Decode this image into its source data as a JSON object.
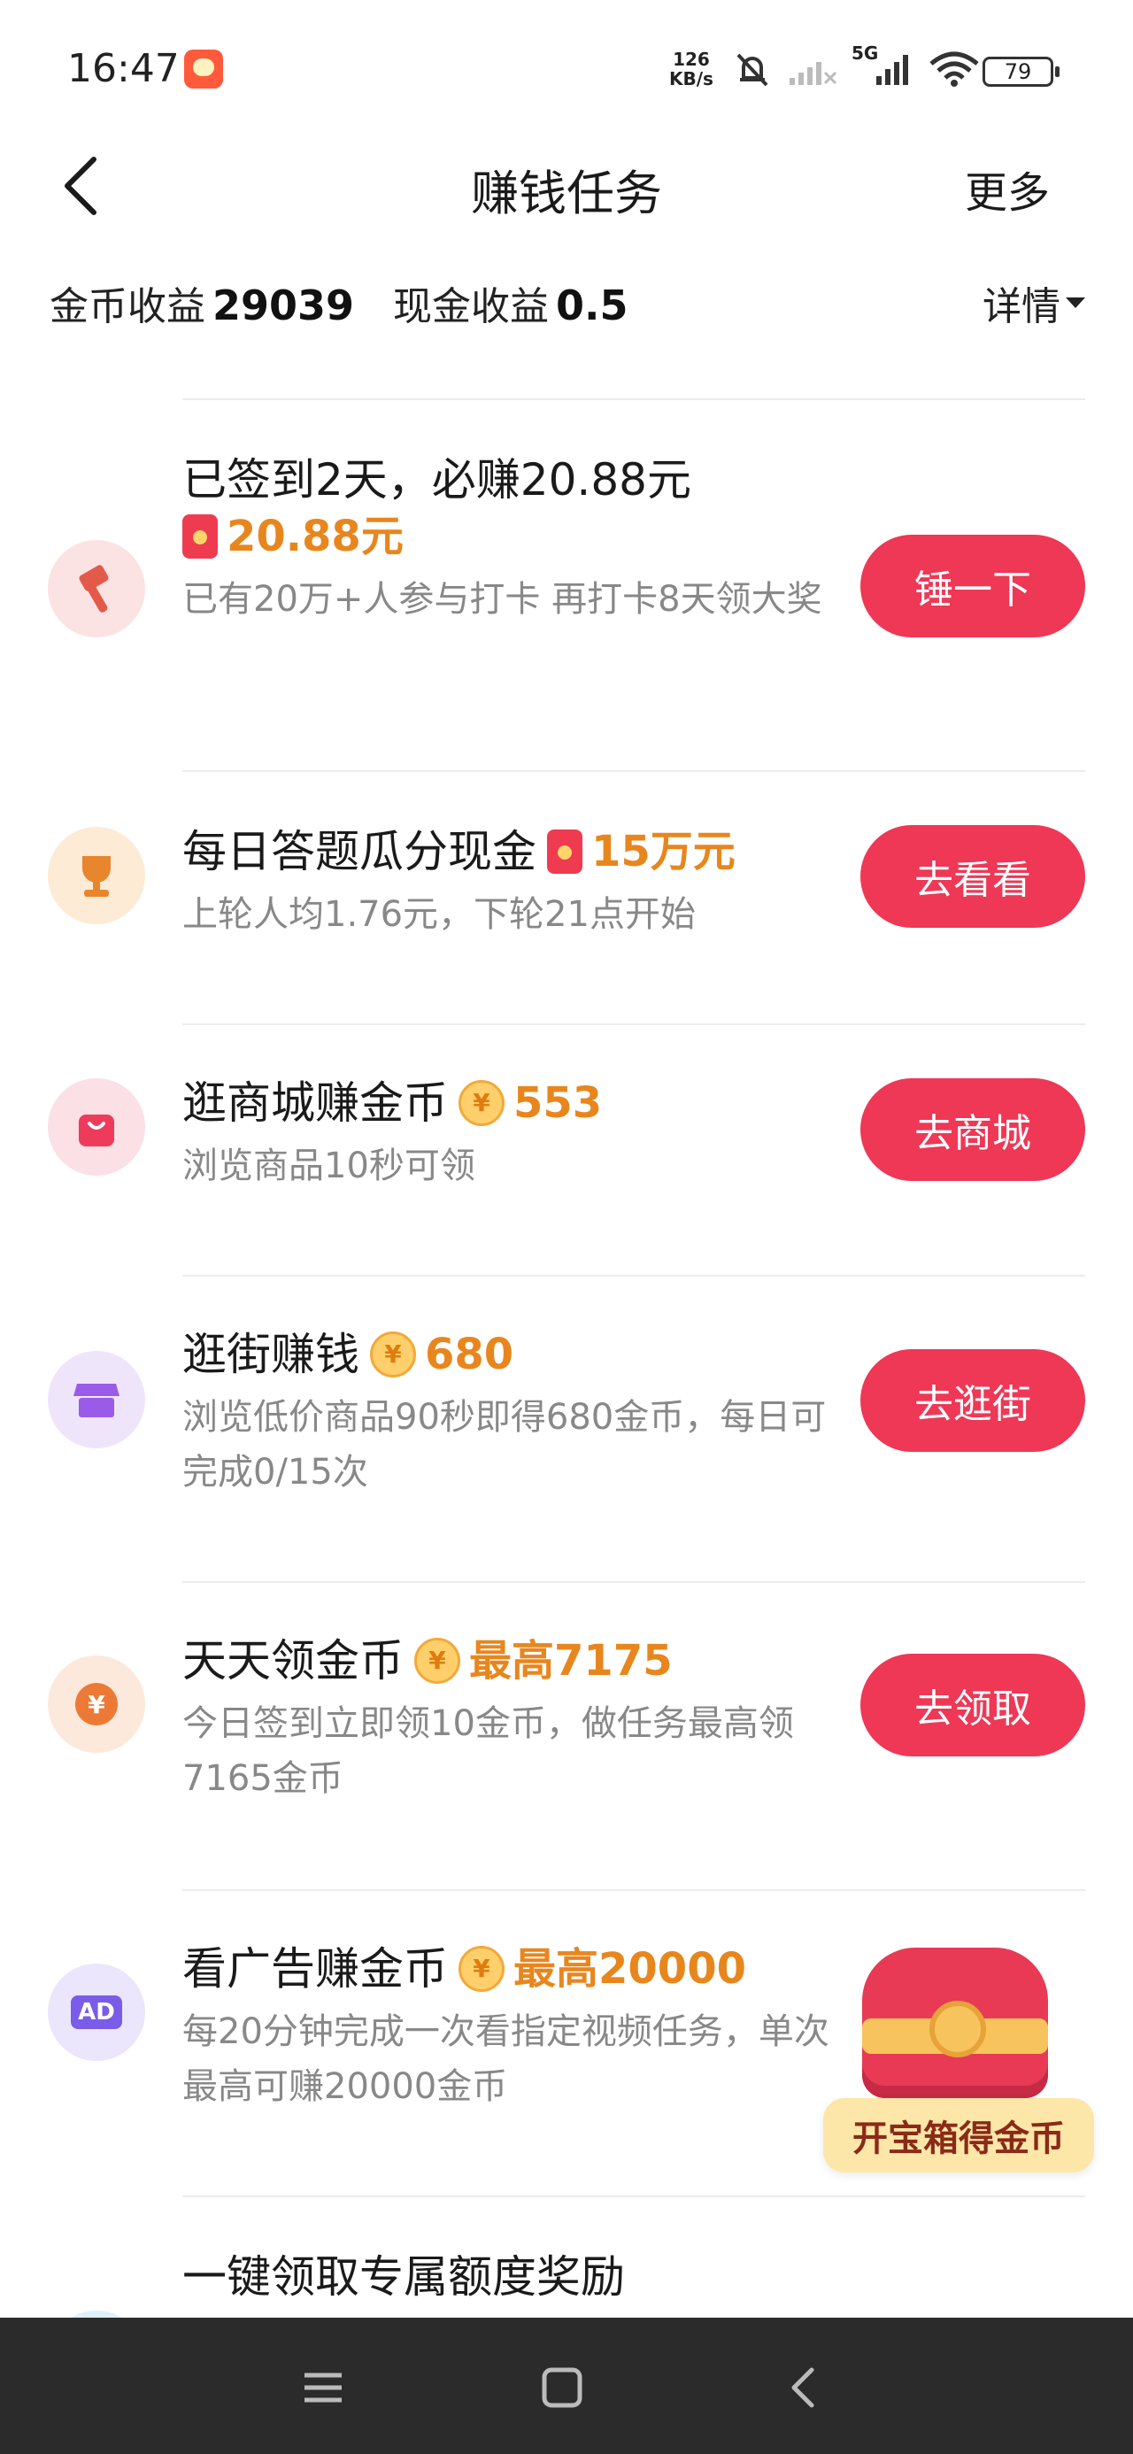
{
  "status_bar": {
    "time": "16:47",
    "net_speed_value": "126",
    "net_speed_unit": "KB/s",
    "network": "5G",
    "battery": "79"
  },
  "header": {
    "title": "赚钱任务",
    "more_label": "更多"
  },
  "earnings": {
    "coin_label": "金币收益",
    "coin_value": "29039",
    "cash_label": "现金收益",
    "cash_value": "0.5",
    "detail_label": "详情"
  },
  "tasks": [
    {
      "title": "已签到2天，必赚20.88元",
      "reward": "20.88元",
      "reward_icon": "red-packet",
      "desc": "已有20万+人参与打卡 再打卡8天领大奖",
      "button": "锤一下",
      "icon": "hammer-icon",
      "icon_bg": "#fbe3e3",
      "icon_color": "#e45a4a"
    },
    {
      "title": "每日答题瓜分现金",
      "reward": "15万元",
      "reward_icon": "red-packet",
      "desc": "上轮人均1.76元，下轮21点开始",
      "button": "去看看",
      "icon": "trophy-icon",
      "icon_bg": "#fdebd6",
      "icon_color": "#e8862e"
    },
    {
      "title": "逛商城赚金币",
      "reward": "553",
      "reward_icon": "coin",
      "desc": "浏览商品10秒可领",
      "button": "去商城",
      "icon": "shopping-bag-icon",
      "icon_bg": "#fbe0e6",
      "icon_color": "#ee3b5c"
    },
    {
      "title": "逛街赚钱",
      "reward": "680",
      "reward_icon": "coin",
      "desc": "浏览低价商品90秒即得680金币，每日可完成0/15次",
      "button": "去逛街",
      "icon": "store-icon",
      "icon_bg": "#efe5fb",
      "icon_color": "#9a5ce8"
    },
    {
      "title": "天天领金币",
      "reward": "最高7175",
      "reward_icon": "coin",
      "desc": "今日签到立即领10金币，做任务最高领7165金币",
      "button": "去领取",
      "icon": "yen-coin-icon",
      "icon_bg": "#fde9dc",
      "icon_color": "#ec7a36"
    },
    {
      "title": "看广告赚金币",
      "reward": "最高20000",
      "reward_icon": "coin",
      "desc": "每20分钟完成一次看指定视频任务，单次最高可赚20000金币",
      "button": "",
      "icon": "ad-icon",
      "icon_bg": "#ebe6fb",
      "icon_color": "#7a5ce8",
      "icon_text": "AD"
    },
    {
      "title": "一键领取专属额度奖励",
      "reward": "",
      "reward_icon": "",
      "desc": "",
      "button": "",
      "icon": "credit-icon",
      "icon_bg": "#e0f0fb",
      "icon_color": "#3a9ae8"
    }
  ],
  "treasure": {
    "label": "开宝箱得金币"
  }
}
